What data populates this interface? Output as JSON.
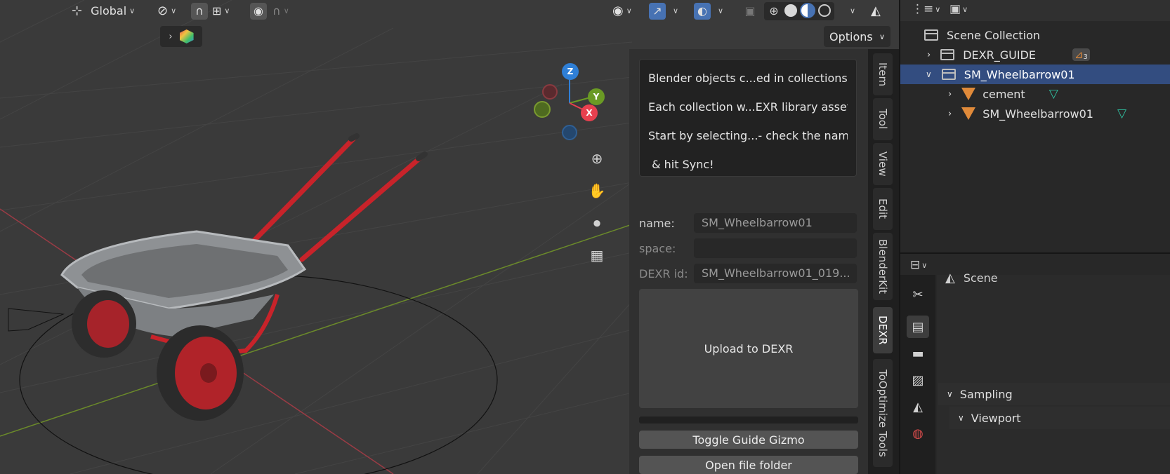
{
  "viewport": {
    "transform_orientation": "Global",
    "options_label": "Options",
    "gizmo_axes": {
      "x": "X",
      "y": "Y",
      "z": "Z"
    }
  },
  "dexr_panel": {
    "guide_lines": [
      "Blender objects c...ed in collections.",
      "Each collection w...EXR library asset.",
      "Start by selecting...- check the name",
      " & hit Sync!"
    ],
    "fields": {
      "name_label": "name:",
      "name_value": "SM_Wheelbarrow01",
      "space_label": "space:",
      "space_value": "",
      "dexr_id_label": "DEXR id:",
      "dexr_id_value": "SM_Wheelbarrow01_019..."
    },
    "upload_label": "Upload to DEXR",
    "toggle_guide_label": "Toggle Guide Gizmo",
    "open_folder_label": "Open file folder"
  },
  "side_tabs": [
    "Item",
    "Tool",
    "View",
    "Edit",
    "BlenderKit",
    "DEXR",
    "ToOptimize Tools"
  ],
  "active_side_tab": "DEXR",
  "outliner": {
    "root": "Scene Collection",
    "items": [
      {
        "label": "DEXR_GUIDE",
        "badge": "3"
      },
      {
        "label": "SM_Wheelbarrow01"
      },
      {
        "label": "cement"
      },
      {
        "label": "SM_Wheelbarrow01"
      }
    ]
  },
  "properties": {
    "scene_label": "Scene",
    "sections": [
      "Sampling",
      "Viewport"
    ]
  },
  "colors": {
    "selection": "#334d80",
    "accent_blue": "#4772b3",
    "axis_x": "#e8404f",
    "axis_y": "#6a9a24",
    "axis_z": "#2f7fd6",
    "mesh_orange": "#e08a3a"
  }
}
